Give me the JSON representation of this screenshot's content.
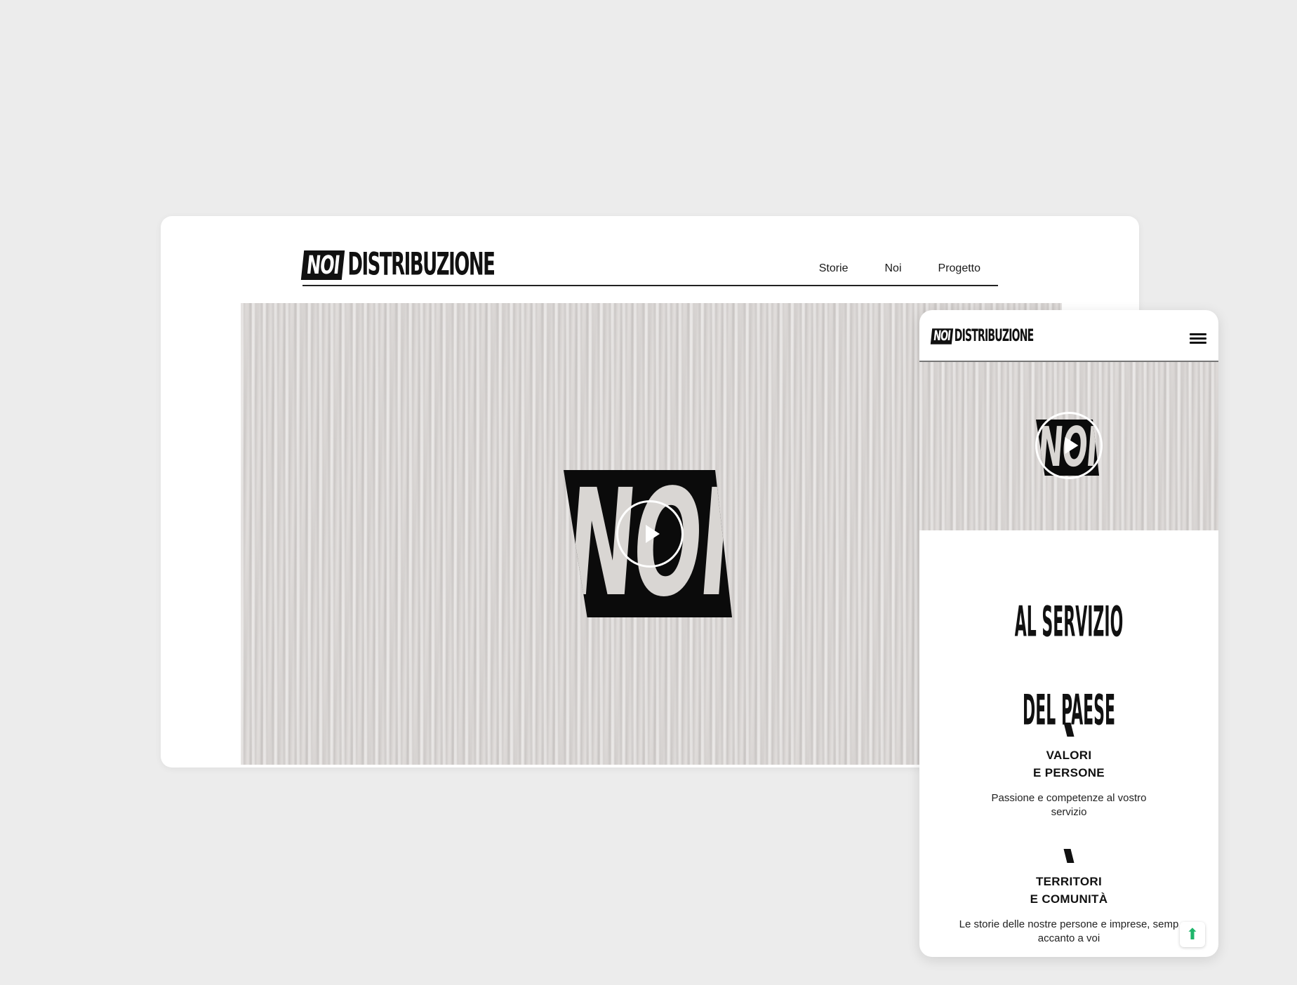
{
  "brand": {
    "logo_mark": "NOI",
    "logo_word": "DISTRIBUZIONE"
  },
  "desktop": {
    "nav": [
      {
        "label": "Storie"
      },
      {
        "label": "Noi"
      },
      {
        "label": "Progetto"
      }
    ],
    "video": {
      "mark": "NOI"
    }
  },
  "mobile": {
    "video": {
      "mark": "NOI"
    },
    "hero": {
      "line1": "AL SERVIZIO",
      "line2": "DEL PAESE"
    },
    "sections": [
      {
        "title_line1": "VALORI",
        "title_line2": "E PERSONE",
        "text": "Passione e competenze al vostro servizio"
      },
      {
        "title_line1": "TERRITORI",
        "title_line2": "E COMUNITÀ",
        "text": "Le storie delle nostre persone e imprese, semp accanto a voi"
      }
    ],
    "scroll_top_icon": "arrow-up-icon"
  },
  "colors": {
    "background": "#ececec",
    "accent": "#1fb56b",
    "ink": "#111111"
  }
}
